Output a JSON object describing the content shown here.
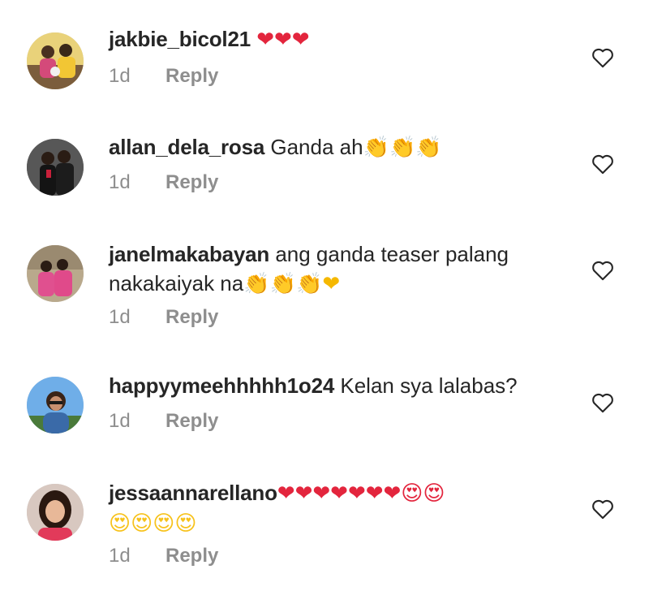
{
  "comments": [
    {
      "username": "jakbie_bicol21",
      "text": "",
      "line2": "",
      "emoji_line1": "❤❤❤",
      "emoji_line2": "",
      "time": "1d",
      "reply_label": "Reply"
    },
    {
      "username": "allan_dela_rosa",
      "text": "Ganda ah",
      "line2": "",
      "emoji_line1": "👏👏👏",
      "emoji_line2": "",
      "time": "1d",
      "reply_label": "Reply"
    },
    {
      "username": "janelmakabayan",
      "text": "ang ganda teaser palang",
      "line2": "nakakaiyak na",
      "emoji_line1": "",
      "emoji_line2": "👏👏👏❤",
      "time": "1d",
      "reply_label": "Reply"
    },
    {
      "username": "happyymeehhhhh1o24",
      "text": "Kelan sya lalabas?",
      "line2": "",
      "emoji_line1": "",
      "emoji_line2": "",
      "time": "1d",
      "reply_label": "Reply"
    },
    {
      "username": "jessaannarellano",
      "text": "",
      "line2": "",
      "emoji_line1": "❤❤❤❤❤❤❤😍😍",
      "emoji_line2": "😍😍😍😍",
      "time": "1d",
      "reply_label": "Reply"
    }
  ],
  "colors": {
    "text": "#262626",
    "meta": "#8e8e8e",
    "heart": "#e3253d",
    "like_outline": "#262626"
  },
  "icons": {
    "like": "heart-outline-icon",
    "heart_emoji": "red-heart",
    "clap_emoji": "clapping-hands",
    "face_emoji": "heart-eyes-face"
  }
}
